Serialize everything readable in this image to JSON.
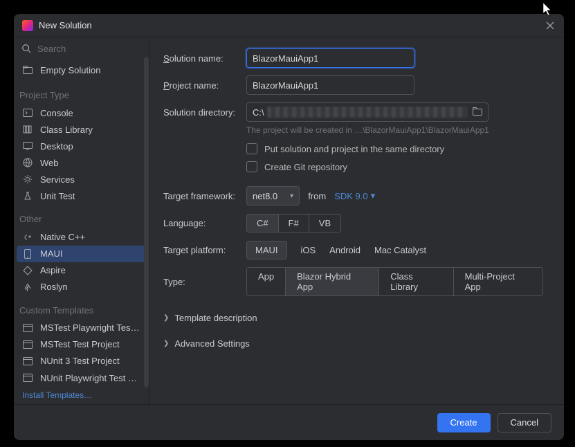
{
  "title": "New Solution",
  "search": {
    "placeholder": "Search"
  },
  "empty_solution": "Empty Solution",
  "sections": {
    "project_type": {
      "label": "Project Type",
      "items": [
        "Console",
        "Class Library",
        "Desktop",
        "Web",
        "Services",
        "Unit Test"
      ]
    },
    "other": {
      "label": "Other",
      "items": [
        "Native C++",
        "MAUI",
        "Aspire",
        "Roslyn"
      ]
    },
    "custom": {
      "label": "Custom Templates",
      "items": [
        "MSTest Playwright Tes…",
        "MSTest Test Project",
        "NUnit 3 Test Project",
        "NUnit Playwright Test …"
      ]
    }
  },
  "install_templates": "Install Templates…",
  "form": {
    "solution_name_label": "Solution name:",
    "solution_name": "BlazorMauiApp1",
    "project_name_label": "Project name:",
    "project_name": "BlazorMauiApp1",
    "solution_dir_label": "Solution directory:",
    "solution_dir": "C:\\",
    "hint": "The project will be created in …\\BlazorMauiApp1\\BlazorMauiApp1",
    "same_dir": "Put solution and project in the same directory",
    "git": "Create Git repository",
    "tf_label": "Target framework:",
    "tf_value": "net8.0",
    "tf_from": "from",
    "tf_sdk": "SDK 9.0",
    "lang_label": "Language:",
    "lang_opts": [
      "C#",
      "F#",
      "VB"
    ],
    "platform_label": "Target platform:",
    "platform_opts": [
      "MAUI",
      "iOS",
      "Android",
      "Mac Catalyst"
    ],
    "type_label": "Type:",
    "type_opts": [
      "App",
      "Blazor Hybrid App",
      "Class Library",
      "Multi-Project App"
    ]
  },
  "expanders": {
    "template_desc": "Template description",
    "advanced": "Advanced Settings"
  },
  "footer": {
    "create": "Create",
    "cancel": "Cancel"
  }
}
